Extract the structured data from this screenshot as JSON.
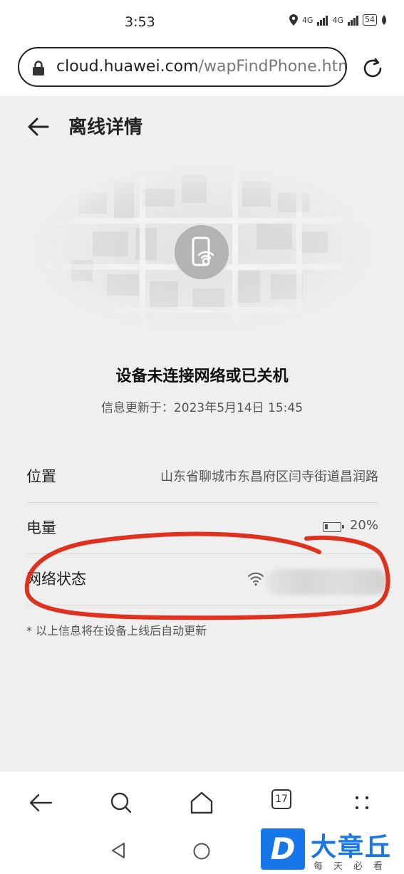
{
  "status_bar": {
    "time": "3:53",
    "network_1": "4G",
    "network_2": "4G",
    "battery": "54"
  },
  "browser": {
    "url_host": "cloud.huawei.com",
    "url_path": "/wapFindPhone.htm"
  },
  "header": {
    "title": "离线详情"
  },
  "status": {
    "headline": "设备未连接网络或已关机",
    "updated": "信息更新于：2023年5月14日 15:45"
  },
  "details": {
    "location": {
      "label": "位置",
      "value": "山东省聊城市东昌府区闫寺街道昌润路"
    },
    "battery": {
      "label": "电量",
      "value": "20%",
      "level": 0.2
    },
    "network": {
      "label": "网络状态"
    }
  },
  "footnote": "* 以上信息将在设备上线后自动更新",
  "toolbar": {
    "tab_count": "17"
  },
  "watermark": {
    "badge": "D",
    "title": "大章丘",
    "subtitle": "每天必看"
  },
  "colors": {
    "annotation": "#e0301e",
    "watermark": "#1877e8",
    "background": "#efefef"
  }
}
